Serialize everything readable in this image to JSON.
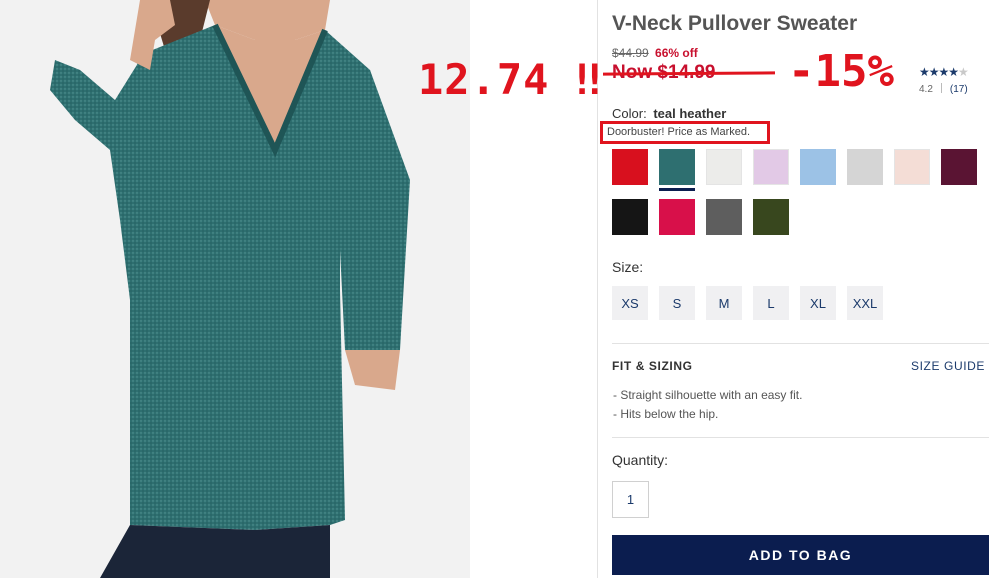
{
  "product": {
    "title": "V-Neck Pullover Sweater",
    "old_price": "$44.99",
    "pct_off": "66% off",
    "now_price": "Now $14.99",
    "rating": {
      "stars": "★★★★",
      "half_star": "★",
      "value": "4.2",
      "count": "(17)",
      "score": 4.2
    },
    "color_label": "Color:",
    "color_value": "teal heather",
    "doorbuster": "Doorbuster! Price as Marked."
  },
  "annotations": {
    "left": "12.74 ‼",
    "right": "-15%"
  },
  "swatches": [
    {
      "name": "red",
      "color": "#d8101e"
    },
    {
      "name": "teal heather",
      "color": "#2e6f70",
      "selected": true
    },
    {
      "name": "off white",
      "color": "#ececea"
    },
    {
      "name": "lilac",
      "color": "#e2c9e6"
    },
    {
      "name": "light blue",
      "color": "#9cc2e6"
    },
    {
      "name": "light grey",
      "color": "#d5d5d5"
    },
    {
      "name": "blush",
      "color": "#f4ddd6"
    },
    {
      "name": "burgundy",
      "color": "#5a1433"
    },
    {
      "name": "black",
      "color": "#151515"
    },
    {
      "name": "pink",
      "color": "#d8104a"
    },
    {
      "name": "charcoal",
      "color": "#5e5e5e"
    },
    {
      "name": "olive",
      "color": "#38471e"
    }
  ],
  "size": {
    "label": "Size:",
    "options": [
      "XS",
      "S",
      "M",
      "L",
      "XL",
      "XXL"
    ]
  },
  "fit": {
    "title": "FIT & SIZING",
    "guide": "SIZE GUIDE",
    "items": [
      "- Straight silhouette with an easy fit.",
      "- Hits below the hip."
    ]
  },
  "quantity": {
    "label": "Quantity:",
    "value": "1"
  },
  "cta": {
    "label": "ADD TO BAG"
  },
  "colors": {
    "navy": "#0b1d4f",
    "sale_red": "#c8102e",
    "annotation_red": "#e0141e",
    "link_blue": "#1b3a6b"
  }
}
